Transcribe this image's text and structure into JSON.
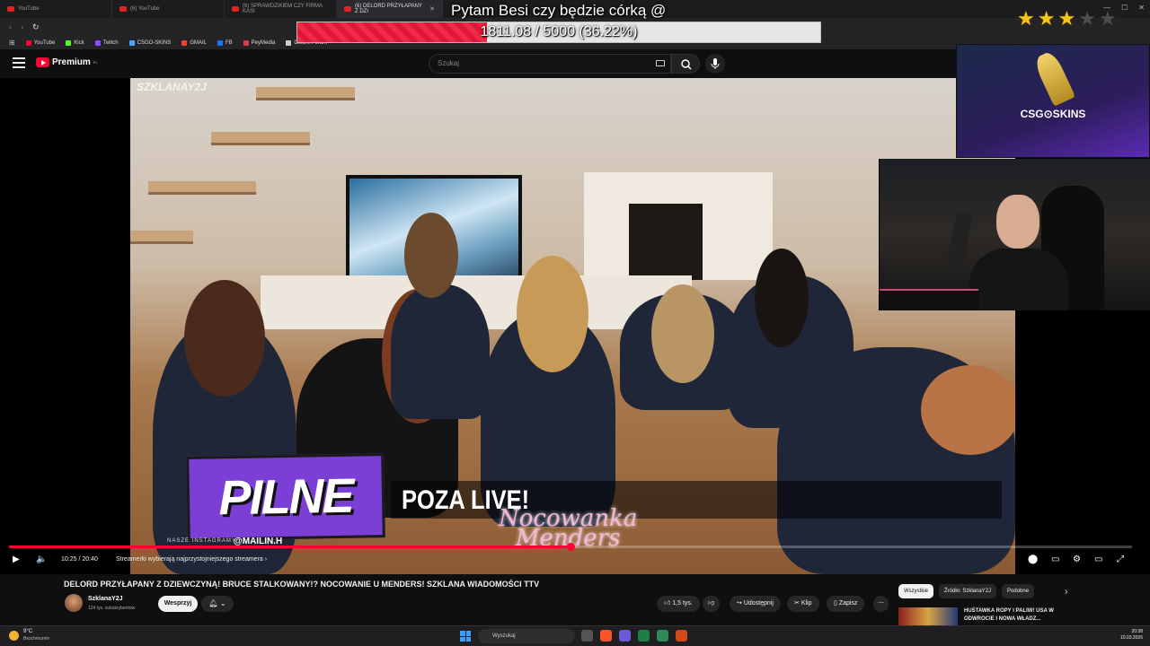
{
  "browser": {
    "tabs": [
      {
        "label": "YouTube",
        "active": false
      },
      {
        "label": "(6) YouTube",
        "active": false
      },
      {
        "label": "(6) SPRAWDZIKIEM CZY FIRMA KASI",
        "active": false
      },
      {
        "label": "(6) DELORD PRZYŁAPANY Z DZI",
        "active": true
      }
    ],
    "bookmarks": [
      {
        "label": "YouTube",
        "color": "#ff0033"
      },
      {
        "label": "Kick",
        "color": "#53fc18"
      },
      {
        "label": "Twitch",
        "color": "#9146ff"
      },
      {
        "label": "CSGO-SKINS",
        "color": "#4aa3ff"
      },
      {
        "label": "GMAIL",
        "color": "#ea4335"
      },
      {
        "label": "FB",
        "color": "#1877f2"
      },
      {
        "label": "PeyMedia",
        "color": "#e63946"
      },
      {
        "label": "Cfkure Forum",
        "color": "#cccccc"
      }
    ]
  },
  "stream_overlay": {
    "goal_title": "Pytam Besi czy będzie córką @",
    "goal_text": "1811.08 / 5000 (36.22%)",
    "goal_progress": 0.3622,
    "stars_total": 5,
    "stars_filled": 3,
    "star_color": "#f5c518",
    "sponsor_label": "CSG⊙SKINS"
  },
  "youtube": {
    "logo_text": "Premium",
    "logo_region": "PL",
    "search_placeholder": "Szukaj",
    "accent_color": "#ff0033"
  },
  "video": {
    "watermark": "SZKLANAY2J",
    "pilne_label": "PILNE",
    "poza_live_label": "POZA LIVE!",
    "instagram_label": "NASZE INSTAGRAMY",
    "instagram_handle": "@MAILIN.H",
    "script_title_line1": "Nocowanka",
    "script_title_line2": "Menders",
    "progress": 0.5,
    "time_display": "10:25 / 20:40",
    "chapter": "Streamerki wybierają najprzystojniejszego streamera"
  },
  "below_video": {
    "title": "DELORD PRZYŁAPANY Z DZIEWCZYNĄ! BRUCE STALKOWANY!? NOCOWANIE U MENDERS! SZKLANA WIADOMOŚCI TTV",
    "channel_name": "SzklanaY2J",
    "subscribers": "124 tys. subskrybentów",
    "support_label": "Wesprzyj",
    "likes": "1,5 tys.",
    "share_label": "Udostępnij",
    "clip_label": "Klip",
    "save_label": "Zapisz",
    "chips": [
      "Wszystkie",
      "Źródło: SzklanaY2J",
      "Podobne"
    ],
    "rec_title": "HUŚTAWKA ROPY I PALIW! USA W ODWROCIE I NOWA WŁADZ..."
  },
  "taskbar": {
    "weather_temp": "9°C",
    "weather_desc": "Bezchmurnie",
    "search_placeholder": "Wyszukaj",
    "time": "20:38",
    "date": "10.03.2026"
  }
}
